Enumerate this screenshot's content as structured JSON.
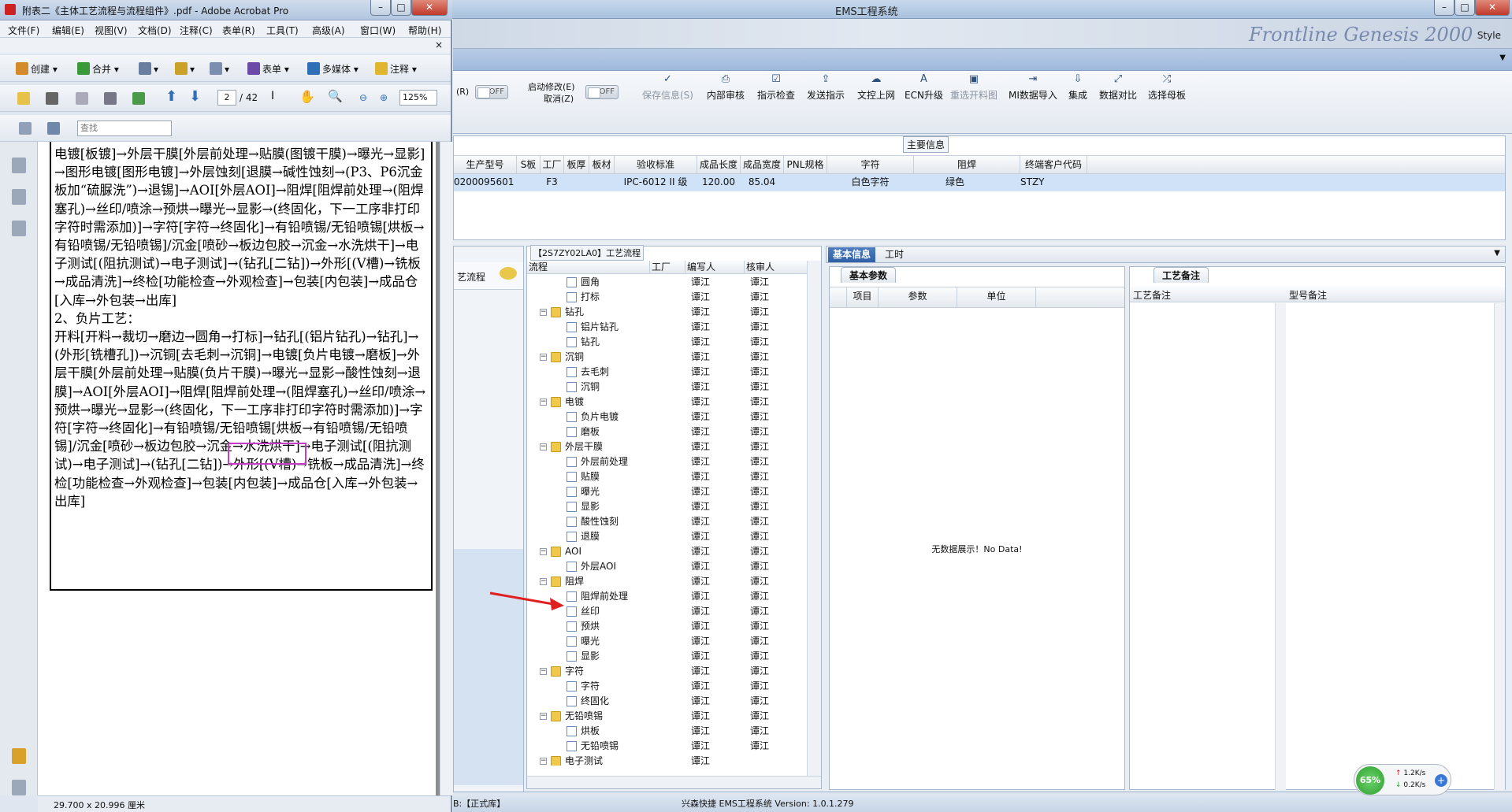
{
  "acrobat": {
    "title": "附表二《主体工艺流程与流程组件》.pdf - Adobe Acrobat Pro",
    "menu": [
      "文件(F)",
      "编辑(E)",
      "视图(V)",
      "文档(D)",
      "注释(C)",
      "表单(R)",
      "工具(T)",
      "高级(A)",
      "窗口(W)",
      "帮助(H)"
    ],
    "toolbar1": [
      "创建",
      "合并",
      "表单",
      "多媒体",
      "注释"
    ],
    "page_current": "2",
    "page_total": "/ 42",
    "zoom": "125%",
    "find_placeholder": "查找",
    "page_size": "29.700 x 20.996 厘米",
    "doc_lines": [
      "电镀[板镀]→外层干膜[外层前处理→贴膜(图镀干膜)→曝光→显影]→图形电镀[图形电镀]→外层蚀刻[退膜→碱性蚀刻→(P3、P6沉金板加“硫脲洗”)→退锡]→AOI[外层AOI]→阻焊[阻焊前处理→(阻焊塞孔)→丝印/喷涂→预烘→曝光→显影→(终固化，下一工序非打印字符时需添加)]→字符[字符→终固化]→有铅喷锡/无铅喷锡[烘板→有铅喷锡/无铅喷锡]/沉金[喷砂→板边包胶→沉金→水洗烘干]→电子测试[(阻抗测试)→电子测试]→(钻孔[二钻])→外形[(V槽)→铣板→成品清洗]→终检[功能检查→外观检查]→包装[内包装]→成品仓[入库→外包装→出库]",
      "2、负片工艺：",
      "开料[开料→裁切→磨边→圆角→打标]→钻孔[(铝片钻孔)→钻孔]→(外形[铣槽孔])→沉铜[去毛刺→沉铜]→电镀[负片电镀→磨板]→外层干膜[外层前处理→贴膜(负片干膜)→曝光→显影→酸性蚀刻→退膜]→AOI[外层AOI]→阻焊[阻焊前处理→(阻焊塞孔)→丝印/喷涂→预烘→曝光→显影→(终固化，下一工序非打印字符时需添加)]→字符[字符→终固化]→有铅喷锡/无铅喷锡[烘板→有铅喷锡/无铅喷锡]/沉金[喷砂→板边包胶→沉金→水洗烘干]→电子测试[(阻抗测试)→电子测试]→(钻孔[二钻])→外形[(V槽)→铣板→成品清洗]→终检[功能检查→外观检查]→包装[内包装]→成品仓[入库→外包装→出库]"
    ]
  },
  "ems": {
    "title": "EMS工程系统",
    "style_label": "Style",
    "brand": "Frontline Genesis 2000",
    "toggle_off": "OFF",
    "edit_label": "启动修改(E)",
    "cancel_label": "取消(Z)",
    "r_label": "(R)",
    "toolbar": [
      {
        "label": "保存信息(S)",
        "icon": "check-icon",
        "enabled": false
      },
      {
        "label": "内部审核",
        "icon": "print-icon",
        "enabled": true
      },
      {
        "label": "指示检查",
        "icon": "check-icon",
        "enabled": true
      },
      {
        "label": "发送指示",
        "icon": "upload-icon",
        "enabled": true
      },
      {
        "label": "文控上网",
        "icon": "cloud-icon",
        "enabled": true
      },
      {
        "label": "ECN升级",
        "icon": "a-icon",
        "enabled": true
      },
      {
        "label": "重选开料图",
        "icon": "image-icon",
        "enabled": false
      },
      {
        "label": "MI数据导入",
        "icon": "import-icon",
        "enabled": true
      },
      {
        "label": "集成",
        "icon": "download-icon",
        "enabled": true
      },
      {
        "label": "数据对比",
        "icon": "compare-icon",
        "enabled": true
      },
      {
        "label": "选择母板",
        "icon": "shuffle-icon",
        "enabled": true
      }
    ],
    "main_info": {
      "title": "主要信息",
      "columns": [
        "生产型号",
        "S板",
        "工厂",
        "板厚",
        "板材",
        "验收标准",
        "成品长度",
        "成品宽度",
        "PNL规格",
        "字符",
        "阻焊",
        "终端客户代码"
      ],
      "row": [
        "0200095601",
        "",
        "F3",
        "",
        "",
        "IPC-6012 II 级",
        "120.00",
        "85.04",
        "",
        "白色字符",
        "绿色",
        "STZY"
      ]
    },
    "left_nav": {
      "label": "艺流程"
    },
    "process_tree": {
      "title": "【2S7ZY02LA0】工艺流程",
      "columns": [
        "流程",
        "工厂",
        "编写人",
        "核审人"
      ],
      "rows": [
        {
          "name": "圆角",
          "level": 2,
          "type": "doc",
          "writer": "谭江",
          "checker": "谭江"
        },
        {
          "name": "打标",
          "level": 2,
          "type": "doc",
          "writer": "谭江",
          "checker": "谭江"
        },
        {
          "name": "钻孔",
          "level": 1,
          "type": "folder",
          "writer": "谭江",
          "checker": "谭江"
        },
        {
          "name": "铝片钻孔",
          "level": 2,
          "type": "doc",
          "writer": "谭江",
          "checker": "谭江"
        },
        {
          "name": "钻孔",
          "level": 2,
          "type": "doc",
          "writer": "谭江",
          "checker": "谭江"
        },
        {
          "name": "沉铜",
          "level": 1,
          "type": "folder",
          "writer": "谭江",
          "checker": "谭江"
        },
        {
          "name": "去毛刺",
          "level": 2,
          "type": "doc",
          "writer": "谭江",
          "checker": "谭江"
        },
        {
          "name": "沉铜",
          "level": 2,
          "type": "doc",
          "writer": "谭江",
          "checker": "谭江"
        },
        {
          "name": "电镀",
          "level": 1,
          "type": "folder",
          "writer": "谭江",
          "checker": "谭江"
        },
        {
          "name": "负片电镀",
          "level": 2,
          "type": "doc",
          "writer": "谭江",
          "checker": "谭江"
        },
        {
          "name": "磨板",
          "level": 2,
          "type": "doc",
          "writer": "谭江",
          "checker": "谭江"
        },
        {
          "name": "外层干膜",
          "level": 1,
          "type": "folder",
          "writer": "谭江",
          "checker": "谭江"
        },
        {
          "name": "外层前处理",
          "level": 2,
          "type": "doc",
          "writer": "谭江",
          "checker": "谭江"
        },
        {
          "name": "贴膜",
          "level": 2,
          "type": "doc",
          "writer": "谭江",
          "checker": "谭江"
        },
        {
          "name": "曝光",
          "level": 2,
          "type": "doc",
          "writer": "谭江",
          "checker": "谭江"
        },
        {
          "name": "显影",
          "level": 2,
          "type": "doc",
          "writer": "谭江",
          "checker": "谭江"
        },
        {
          "name": "酸性蚀刻",
          "level": 2,
          "type": "doc",
          "writer": "谭江",
          "checker": "谭江"
        },
        {
          "name": "退膜",
          "level": 2,
          "type": "doc",
          "writer": "谭江",
          "checker": "谭江"
        },
        {
          "name": "AOI",
          "level": 1,
          "type": "folder",
          "writer": "谭江",
          "checker": "谭江"
        },
        {
          "name": "外层AOI",
          "level": 2,
          "type": "doc",
          "writer": "谭江",
          "checker": "谭江"
        },
        {
          "name": "阻焊",
          "level": 1,
          "type": "folder",
          "writer": "谭江",
          "checker": "谭江"
        },
        {
          "name": "阻焊前处理",
          "level": 2,
          "type": "doc",
          "writer": "谭江",
          "checker": "谭江"
        },
        {
          "name": "丝印",
          "level": 2,
          "type": "doc",
          "writer": "谭江",
          "checker": "谭江"
        },
        {
          "name": "预烘",
          "level": 2,
          "type": "doc",
          "writer": "谭江",
          "checker": "谭江"
        },
        {
          "name": "曝光",
          "level": 2,
          "type": "doc",
          "writer": "谭江",
          "checker": "谭江"
        },
        {
          "name": "显影",
          "level": 2,
          "type": "doc",
          "writer": "谭江",
          "checker": "谭江"
        },
        {
          "name": "字符",
          "level": 1,
          "type": "folder",
          "writer": "谭江",
          "checker": "谭江"
        },
        {
          "name": "字符",
          "level": 2,
          "type": "doc",
          "writer": "谭江",
          "checker": "谭江"
        },
        {
          "name": "终固化",
          "level": 2,
          "type": "doc",
          "writer": "谭江",
          "checker": "谭江"
        },
        {
          "name": "无铅喷锡",
          "level": 1,
          "type": "folder",
          "writer": "谭江",
          "checker": "谭江"
        },
        {
          "name": "烘板",
          "level": 2,
          "type": "doc",
          "writer": "谭江",
          "checker": "谭江"
        },
        {
          "name": "无铅喷锡",
          "level": 2,
          "type": "doc",
          "writer": "谭江",
          "checker": "谭江"
        },
        {
          "name": "电子测试",
          "level": 1,
          "type": "folder",
          "writer": "谭江",
          "checker": ""
        }
      ]
    },
    "right_tabs": [
      "基本信息",
      "工时"
    ],
    "basic_params": {
      "tab": "基本参数",
      "columns": [
        "项目",
        "参数",
        "单位"
      ],
      "empty": "无数据展示！No Data!"
    },
    "remarks": {
      "tab": "工艺备注",
      "columns": [
        "工艺备注",
        "型号备注"
      ]
    },
    "status": {
      "left": "B:【正式库】",
      "center": "兴森快捷 EMS工程系统 Version: 1.0.1.279"
    },
    "net": {
      "percent": "65%",
      "up": "1.2K/s",
      "down": "0.2K/s"
    }
  }
}
